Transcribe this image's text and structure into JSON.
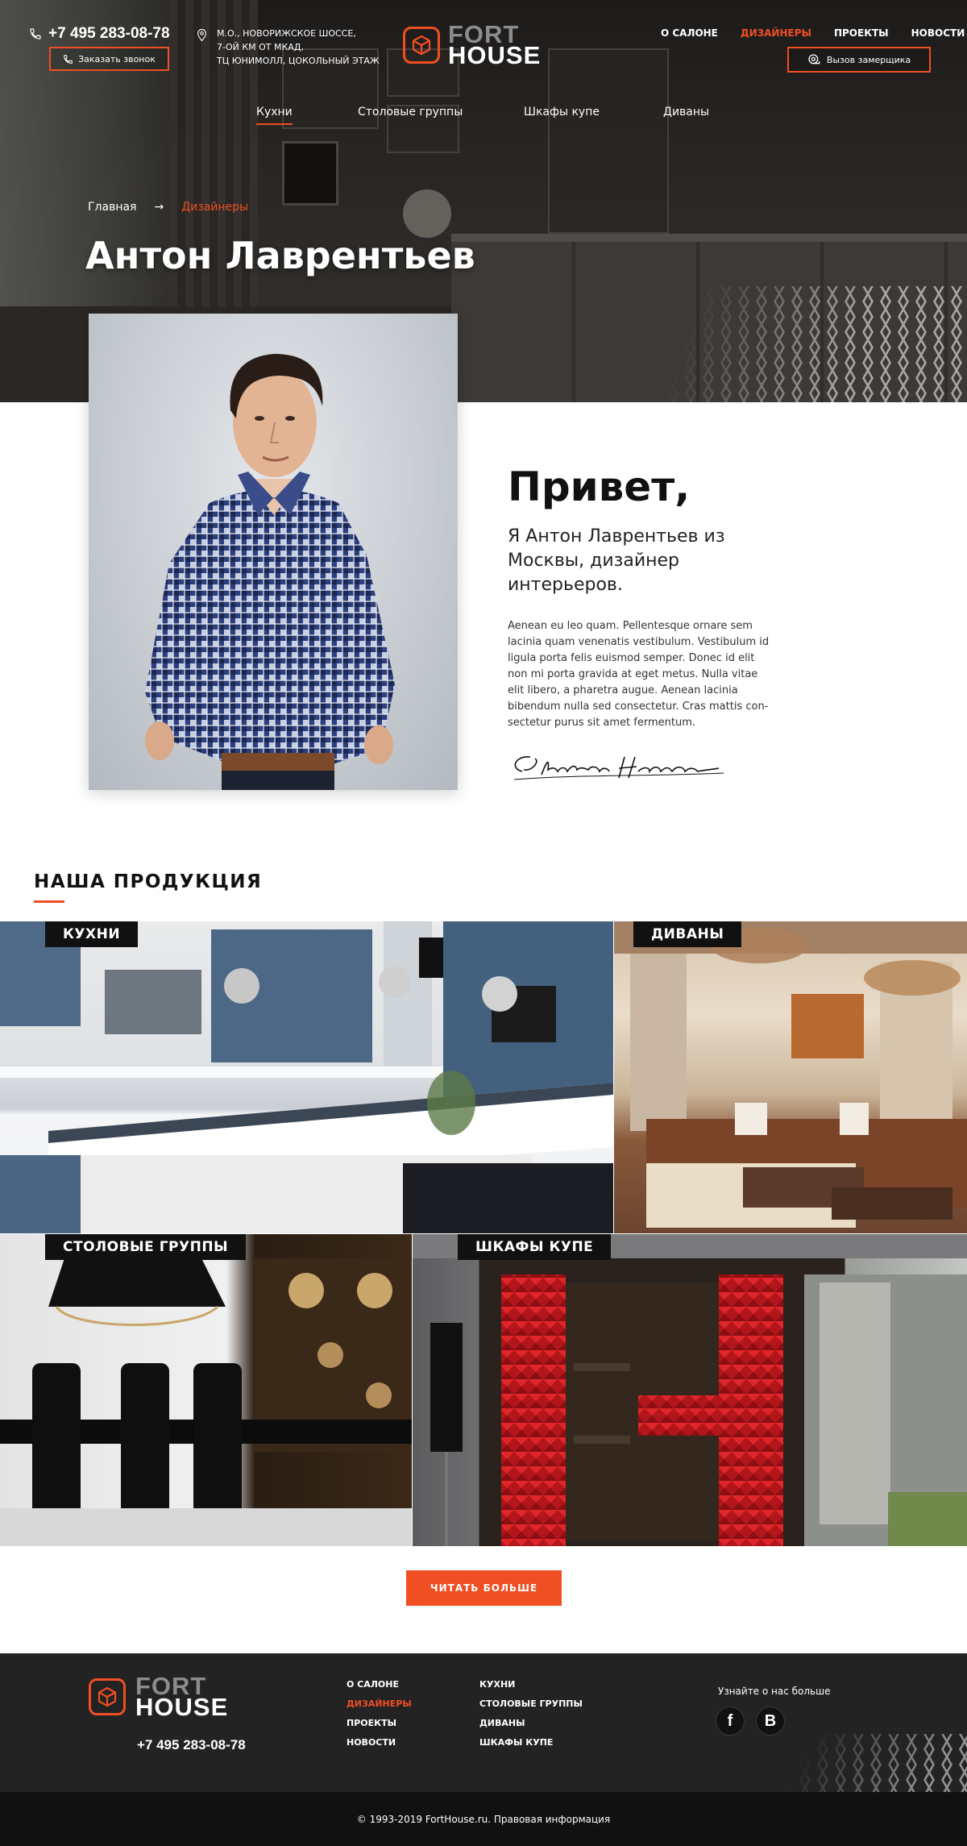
{
  "header": {
    "phone": "+7 495 283-08-78",
    "call_button": "Заказать звонок",
    "address_lines": [
      "М.О., НОВОРИЖСКОЕ ШОССЕ,",
      "7-ОЙ КМ ОТ МКАД,",
      "ТЦ ЮНИМОЛЛ, ЦОКОЛЬНЫЙ ЭТАЖ"
    ],
    "logo_top": "FORT",
    "logo_bottom": "HOUSE",
    "nav": [
      "О САЛОНЕ",
      "ДИЗАЙНЕРЫ",
      "ПРОЕКТЫ",
      "НОВОСТИ"
    ],
    "nav_active": "ДИЗАЙНЕРЫ",
    "measure_button": "Вызов замерщика"
  },
  "categories_nav": [
    "Кухни",
    "Столовые группы",
    "Шкафы купе",
    "Диваны"
  ],
  "breadcrumb": {
    "home": "Главная",
    "separator": "→",
    "current": "Дизайнеры"
  },
  "hero_title": "Антон Лаврентьев",
  "about": {
    "greeting": "Привет,",
    "intro": "Я Антон Лаврентьев из Москвы, дизайнер интерьеров.",
    "text": "Aenean eu leo quam. Pellentesque ornare sem lacinia quam venenatis vestibulum. Vestibulum id ligula porta felis euismod semper. Donec id elit non mi porta gravida at eget metus. Nulla vitae elit libero, a pharetra augue. Aenean lacinia bibendum nulla sed consectetur. Cras mattis con-sectetur purus sit amet fermentum.",
    "signature": "Clayton Herrera"
  },
  "products": {
    "title": "НАША ПРОДУКЦИЯ",
    "tiles": [
      "КУХНИ",
      "ДИВАНЫ",
      "СТОЛОВЫЕ ГРУППЫ",
      "ШКАФЫ КУПЕ"
    ],
    "read_more": "ЧИТАТЬ БОЛЬШЕ"
  },
  "footer": {
    "logo_top": "FORT",
    "logo_bottom": "HOUSE",
    "phone": "+7 495 283-08-78",
    "col1": [
      "О САЛОНЕ",
      "ДИЗАЙНЕРЫ",
      "ПРОЕКТЫ",
      "НОВОСТИ"
    ],
    "col1_active": "ДИЗАЙНЕРЫ",
    "col2": [
      "КУХНИ",
      "СТОЛОВЫЕ ГРУППЫ",
      "ДИВАНЫ",
      "ШКАФЫ КУПЕ"
    ],
    "social_label": "Узнайте о нас больше",
    "social": [
      "f",
      "B"
    ],
    "copyright": "© 1993-2019 FortHouse.ru. Правовая информация"
  },
  "colors": {
    "accent": "#f04e23",
    "dark": "#232323",
    "footer_bottom": "#111111"
  },
  "icons": [
    "phone-icon",
    "location-pin-icon",
    "logo-cube-icon",
    "tape-measure-icon",
    "facebook-icon",
    "vk-icon"
  ]
}
